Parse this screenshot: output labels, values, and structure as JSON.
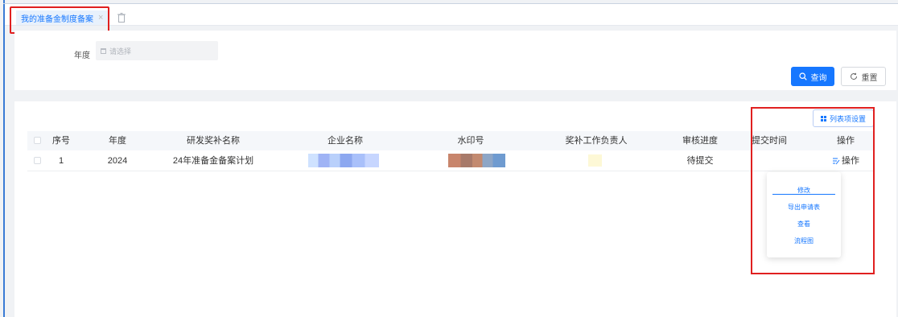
{
  "tabs": [
    {
      "label": "我的准备金制度备案",
      "close": "×"
    }
  ],
  "filter": {
    "year_label": "年度",
    "year_placeholder": "请选择"
  },
  "buttons": {
    "query": "查询",
    "reset": "重置",
    "column_settings": "列表项设置"
  },
  "table": {
    "headers": [
      "序号",
      "年度",
      "研发奖补名称",
      "企业名称",
      "水印号",
      "奖补工作负责人",
      "审核进度",
      "提交时间",
      "操作"
    ],
    "rows": [
      {
        "index": "1",
        "year": "2024",
        "name": "24年准备金备案计划",
        "company": "",
        "watermark": "",
        "person": "",
        "status": "待提交",
        "submit_time": "",
        "action": "操作"
      }
    ]
  },
  "action_menu": {
    "items": [
      "修改",
      "导出申请表",
      "查看",
      "流程图"
    ]
  },
  "colors": {
    "accent": "#1677ff",
    "highlight_border": "#e02020"
  }
}
